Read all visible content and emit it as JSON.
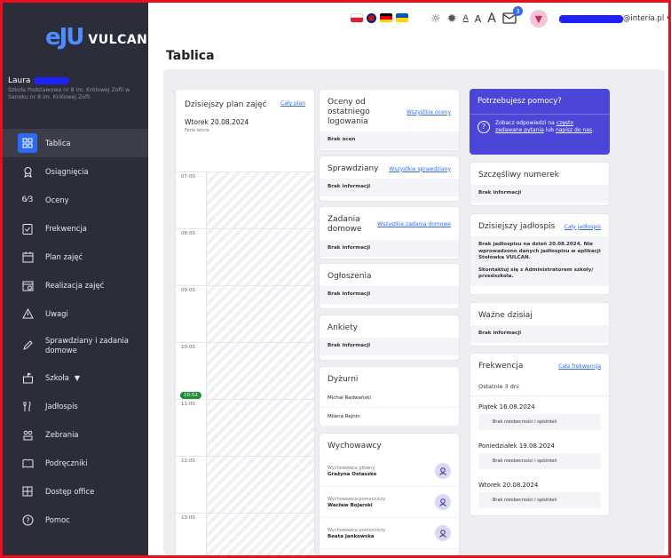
{
  "colors": {
    "sidebar_bg": "#2b2d3a",
    "accent": "#2e6bf0",
    "help_bg": "#4b45d8",
    "now_green": "#1f8f3a"
  },
  "brand": {
    "logo_mark": "eJU",
    "logo_text": "VULCAN"
  },
  "user": {
    "name": "Laura",
    "school": "Szkoła Podstawowa nr 8 im. Królowej Zofii w Sanoku nr 8 im. Królowej Zofii"
  },
  "sidebar": {
    "items": [
      {
        "label": "Tablica",
        "icon": "dashboard-icon"
      },
      {
        "label": "Osiągnięcia",
        "icon": "trophy-icon"
      },
      {
        "label": "Oceny",
        "icon": "grades-icon"
      },
      {
        "label": "Frekwencja",
        "icon": "clipboard-check-icon"
      },
      {
        "label": "Plan zajęć",
        "icon": "calendar-icon"
      },
      {
        "label": "Realizacja zajęć",
        "icon": "calendar-check-icon"
      },
      {
        "label": "Uwagi",
        "icon": "warning-icon"
      },
      {
        "label": "Sprawdziany i zadania domowe",
        "icon": "pen-icon"
      },
      {
        "label": "Szkoła",
        "icon": "school-icon"
      },
      {
        "label": "Jadłospis",
        "icon": "cutlery-icon"
      },
      {
        "label": "Zebrania",
        "icon": "meeting-icon"
      },
      {
        "label": "Podręczniki",
        "icon": "book-icon"
      },
      {
        "label": "Dostęp office",
        "icon": "grid-icon"
      },
      {
        "label": "Pomoc",
        "icon": "help-icon"
      }
    ]
  },
  "topbar": {
    "font_small": "A",
    "font_medium": "A",
    "font_large": "A",
    "notification_count": "3",
    "account_suffix": "@interia.pl"
  },
  "page": {
    "title": "Tablica"
  },
  "plan": {
    "title": "Dzisiejszy plan zajęć",
    "link": "Cały plan",
    "date": "Wtorek 20.08.2024",
    "note": "Ferie letnie",
    "hours": [
      "07:00",
      "08:00",
      "09:00",
      "10:00",
      "11:00",
      "12:00",
      "13:00"
    ],
    "now": "10:52"
  },
  "grades": {
    "title": "Oceny od ostatniego logowania",
    "link": "Wszystkie oceny",
    "empty": "Brak ocen"
  },
  "tests": {
    "title": "Sprawdziany",
    "link": "Wszystkie sprawdziany",
    "empty": "Brak informacji"
  },
  "homework": {
    "title": "Zadania domowe",
    "link": "Wszystkie zadania domowe",
    "empty": "Brak informacji"
  },
  "announcements": {
    "title": "Ogłoszenia",
    "empty": "Brak informacji"
  },
  "surveys": {
    "title": "Ankiety",
    "empty": "Brak informacji"
  },
  "duty": {
    "title": "Dyżurni",
    "people": [
      "Michał Radwański",
      "Milena Rejnin"
    ]
  },
  "tutors": {
    "title": "Wychowawcy",
    "list": [
      {
        "role": "Wychowawca główny",
        "name": "Grażyna Ostaszko"
      },
      {
        "role": "Wychowawca pomocniczy",
        "name": "Wacław Bojarski"
      },
      {
        "role": "Wychowawca pomocniczy",
        "name": "Beata Jankowska"
      }
    ]
  },
  "help": {
    "title": "Potrzebujesz pomocy?",
    "text_pre": "Zobacz odpowiedzi na ",
    "link1": "często zadawane pytania",
    "text_mid": " lub ",
    "link2": "napisz do nas",
    "text_post": "."
  },
  "lucky": {
    "title": "Szczęśliwy numerek",
    "empty": "Brak informacji"
  },
  "menu": {
    "title": "Dzisiejszy jadłospis",
    "link": "Cały jadłospis",
    "text1": "Brak jadłospisu na dzień 20.08.2024. Nie wprowadzono danych jadłospisu w aplikacji Stołówka VULCAN.",
    "text2": "Skontaktuj się z Administratorem szkoły/ przedszkola."
  },
  "important": {
    "title": "Ważne dzisiaj",
    "empty": "Brak informacji"
  },
  "attendance": {
    "title": "Frekwencja",
    "link": "Cała frekwencja",
    "subtitle": "Ostatnie 3 dni",
    "days": [
      {
        "day": "Piątek 16.08.2024",
        "status": "Brak nieobecności i spóźnień"
      },
      {
        "day": "Poniedziałek 19.08.2024",
        "status": "Brak nieobecności i spóźnień"
      },
      {
        "day": "Wtorek 20.08.2024",
        "status": "Brak nieobecności i spóźnień"
      }
    ]
  }
}
